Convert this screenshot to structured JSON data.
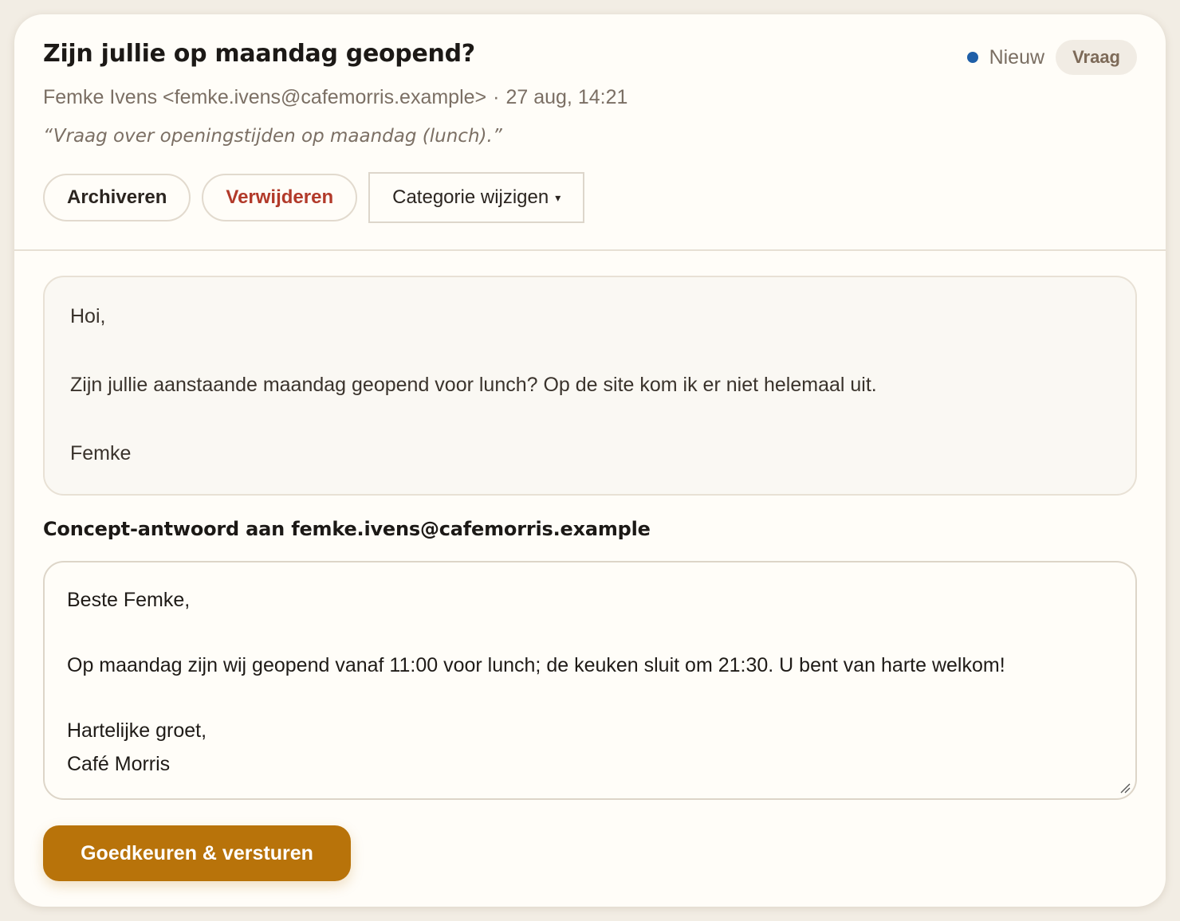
{
  "email": {
    "subject": "Zijn jullie op maandag geopend?",
    "sender": "Femke Ivens <femke.ivens@cafemorris.example>",
    "separator": "·",
    "date": "27 aug, 14:21",
    "summary": "“Vraag over openingstijden op maandag (lunch).”",
    "status_label": "Nieuw",
    "category_badge": "Vraag",
    "body": {
      "greeting": "Hoi,",
      "text": "Zijn jullie aanstaande maandag geopend voor lunch? Op de site kom ik er niet helemaal uit.",
      "signature": "Femke"
    }
  },
  "actions": {
    "archive_label": "Archiveren",
    "delete_label": "Verwijderen",
    "category_label": "Categorie wijzigen",
    "caret": "▾"
  },
  "draft": {
    "heading": "Concept-antwoord aan femke.ivens@cafemorris.example",
    "greeting": "Beste Femke,",
    "text": "Op maandag zijn wij geopend vanaf 11:00 voor lunch; de keuken sluit om 21:30. U bent van harte welkom!",
    "closing": "Hartelijke groet,",
    "sender_name": "Café Morris"
  },
  "send_label": "Goedkeuren & versturen",
  "colors": {
    "status_dot": "#1f5fa8",
    "danger": "#b23a2a",
    "accent": "#b8730a",
    "badge_bg": "#f1ece4"
  },
  "icons": {
    "status": "status-dot",
    "dropdown": "chevron-down-icon",
    "resize": "resize-handle-icon"
  }
}
